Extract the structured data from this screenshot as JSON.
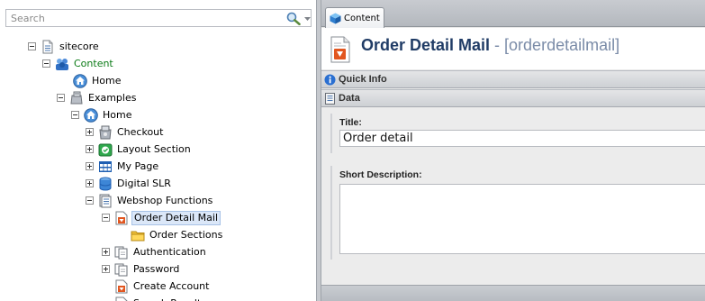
{
  "search": {
    "placeholder": "Search"
  },
  "tree": {
    "items": [
      {
        "label": "sitecore",
        "icon": "document-icon",
        "toggle": "minus"
      },
      {
        "label": "Content",
        "icon": "content-icon",
        "toggle": "minus",
        "color": "#0a7a15"
      },
      {
        "label": "Home",
        "icon": "home-icon",
        "toggle": "none"
      },
      {
        "label": "Examples",
        "icon": "examples-icon",
        "toggle": "minus"
      },
      {
        "label": "Home",
        "icon": "home-icon",
        "toggle": "minus"
      },
      {
        "label": "Checkout",
        "icon": "checkout-icon",
        "toggle": "plus"
      },
      {
        "label": "Layout Section",
        "icon": "layout-icon",
        "toggle": "plus"
      },
      {
        "label": "My Page",
        "icon": "grid-icon",
        "toggle": "plus"
      },
      {
        "label": "Digital SLR",
        "icon": "database-icon",
        "toggle": "plus"
      },
      {
        "label": "Webshop Functions",
        "icon": "webshop-icon",
        "toggle": "minus"
      },
      {
        "label": "Order Detail Mail",
        "icon": "mail-document-icon",
        "toggle": "minus",
        "selected": true
      },
      {
        "label": "Order Sections",
        "icon": "folder-icon",
        "toggle": "none"
      },
      {
        "label": "Authentication",
        "icon": "pages-icon",
        "toggle": "plus"
      },
      {
        "label": "Password",
        "icon": "pages-icon",
        "toggle": "plus"
      },
      {
        "label": "Create Account",
        "icon": "mail-document-icon",
        "toggle": "none"
      },
      {
        "label": "Search Result",
        "icon": "mail-document-icon",
        "toggle": "none"
      }
    ]
  },
  "editor": {
    "tab_label": "Content",
    "item_title": "Order Detail Mail",
    "item_key": " - [orderdetailmail]",
    "sections": {
      "quick_info": "Quick Info",
      "data": "Data"
    },
    "fields": {
      "title_label": "Title:",
      "title_value": "Order detail",
      "short_description_label": "Short Description:",
      "short_description_value": ""
    }
  },
  "colors": {
    "title_blue": "#203c66",
    "key_gray": "#7b8ca8",
    "content_green": "#0a7a15"
  }
}
